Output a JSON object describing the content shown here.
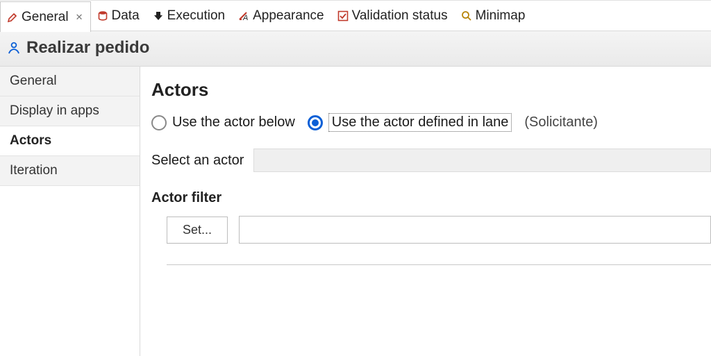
{
  "tabs": [
    {
      "label": "General",
      "icon": "pencil-icon",
      "active": true
    },
    {
      "label": "Data",
      "icon": "database-icon",
      "active": false
    },
    {
      "label": "Execution",
      "icon": "exec-icon",
      "active": false
    },
    {
      "label": "Appearance",
      "icon": "appearance-icon",
      "active": false
    },
    {
      "label": "Validation status",
      "icon": "check-icon",
      "active": false
    },
    {
      "label": "Minimap",
      "icon": "magnifier-icon",
      "active": false
    }
  ],
  "subject": {
    "title": "Realizar pedido"
  },
  "side_nav": [
    {
      "label": "General",
      "selected": false
    },
    {
      "label": "Display in apps",
      "selected": false
    },
    {
      "label": "Actors",
      "selected": true
    },
    {
      "label": "Iteration",
      "selected": false
    }
  ],
  "actors_panel": {
    "heading": "Actors",
    "radio_below_label": "Use the actor below",
    "radio_lane_label": "Use the actor defined in lane",
    "lane_name": "(Solicitante)",
    "select_actor_label": "Select an actor",
    "filter_label": "Actor filter",
    "set_button_label": "Set...",
    "filter_value": ""
  }
}
